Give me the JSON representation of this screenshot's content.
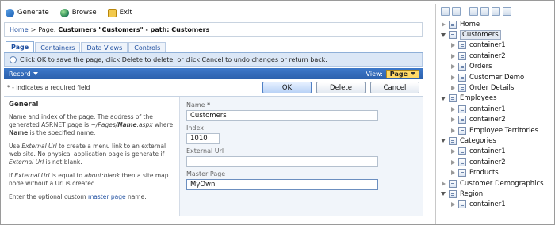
{
  "toolbar": {
    "generate": "Generate",
    "browse": "Browse",
    "exit": "Exit"
  },
  "breadcrumb": {
    "home": "Home",
    "separator": ">",
    "prefix": "Page:",
    "title": "Customers \"Customers\" - path: Customers"
  },
  "tabs": [
    "Page",
    "Containers",
    "Data Views",
    "Controls"
  ],
  "hint": "Click OK to save the page, click Delete to delete, or click Cancel to undo changes or return back.",
  "recordbar": {
    "record": "Record",
    "view_label": "View:",
    "view_value": "Page"
  },
  "required_note": "* - indicates a required field",
  "buttons": {
    "ok": "OK",
    "delete": "Delete",
    "cancel": "Cancel"
  },
  "description": {
    "heading": "General",
    "p1_a": "Name and index of the page. The address of the generated ASP.NET page is ",
    "p1_b": "~/Pages/",
    "p1_c": "Name",
    "p1_d": ".aspx",
    "p1_e": " where ",
    "p1_f": "Name",
    "p1_g": " is the specified name.",
    "p2_a": "Use ",
    "p2_b": "External Url",
    "p2_c": " to create a menu link to an external web site. No physical application page is generate if ",
    "p2_d": "External Url",
    "p2_e": " is not blank.",
    "p3_a": "If ",
    "p3_b": "External Url",
    "p3_c": " is equal to ",
    "p3_d": "about:blank",
    "p3_e": " then a site map node without a Url is created.",
    "p4_a": "Enter the optional custom ",
    "p4_link": "master page",
    "p4_b": " name."
  },
  "form": {
    "name_label": "Name",
    "name_req": "*",
    "name_value": "Customers",
    "index_label": "Index",
    "index_value": "1010",
    "url_label": "External Url",
    "url_value": "",
    "master_label": "Master Page",
    "master_value": "MyOwn"
  },
  "tree": [
    {
      "label": "Home",
      "level": 0,
      "state": "closed"
    },
    {
      "label": "Customers",
      "level": 0,
      "state": "open",
      "selected": true
    },
    {
      "label": "container1",
      "level": 1,
      "state": "closed"
    },
    {
      "label": "container2",
      "level": 1,
      "state": "closed"
    },
    {
      "label": "Orders",
      "level": 1,
      "state": "closed"
    },
    {
      "label": "Customer Demo",
      "level": 1,
      "state": "closed"
    },
    {
      "label": "Order Details",
      "level": 1,
      "state": "closed"
    },
    {
      "label": "Employees",
      "level": 0,
      "state": "open"
    },
    {
      "label": "container1",
      "level": 1,
      "state": "closed"
    },
    {
      "label": "container2",
      "level": 1,
      "state": "closed"
    },
    {
      "label": "Employee Territories",
      "level": 1,
      "state": "closed"
    },
    {
      "label": "Categories",
      "level": 0,
      "state": "open"
    },
    {
      "label": "container1",
      "level": 1,
      "state": "closed"
    },
    {
      "label": "container2",
      "level": 1,
      "state": "closed"
    },
    {
      "label": "Products",
      "level": 1,
      "state": "closed"
    },
    {
      "label": "Customer Demographics",
      "level": 0,
      "state": "closed"
    },
    {
      "label": "Region",
      "level": 0,
      "state": "open"
    },
    {
      "label": "container1",
      "level": 1,
      "state": "closed"
    }
  ]
}
